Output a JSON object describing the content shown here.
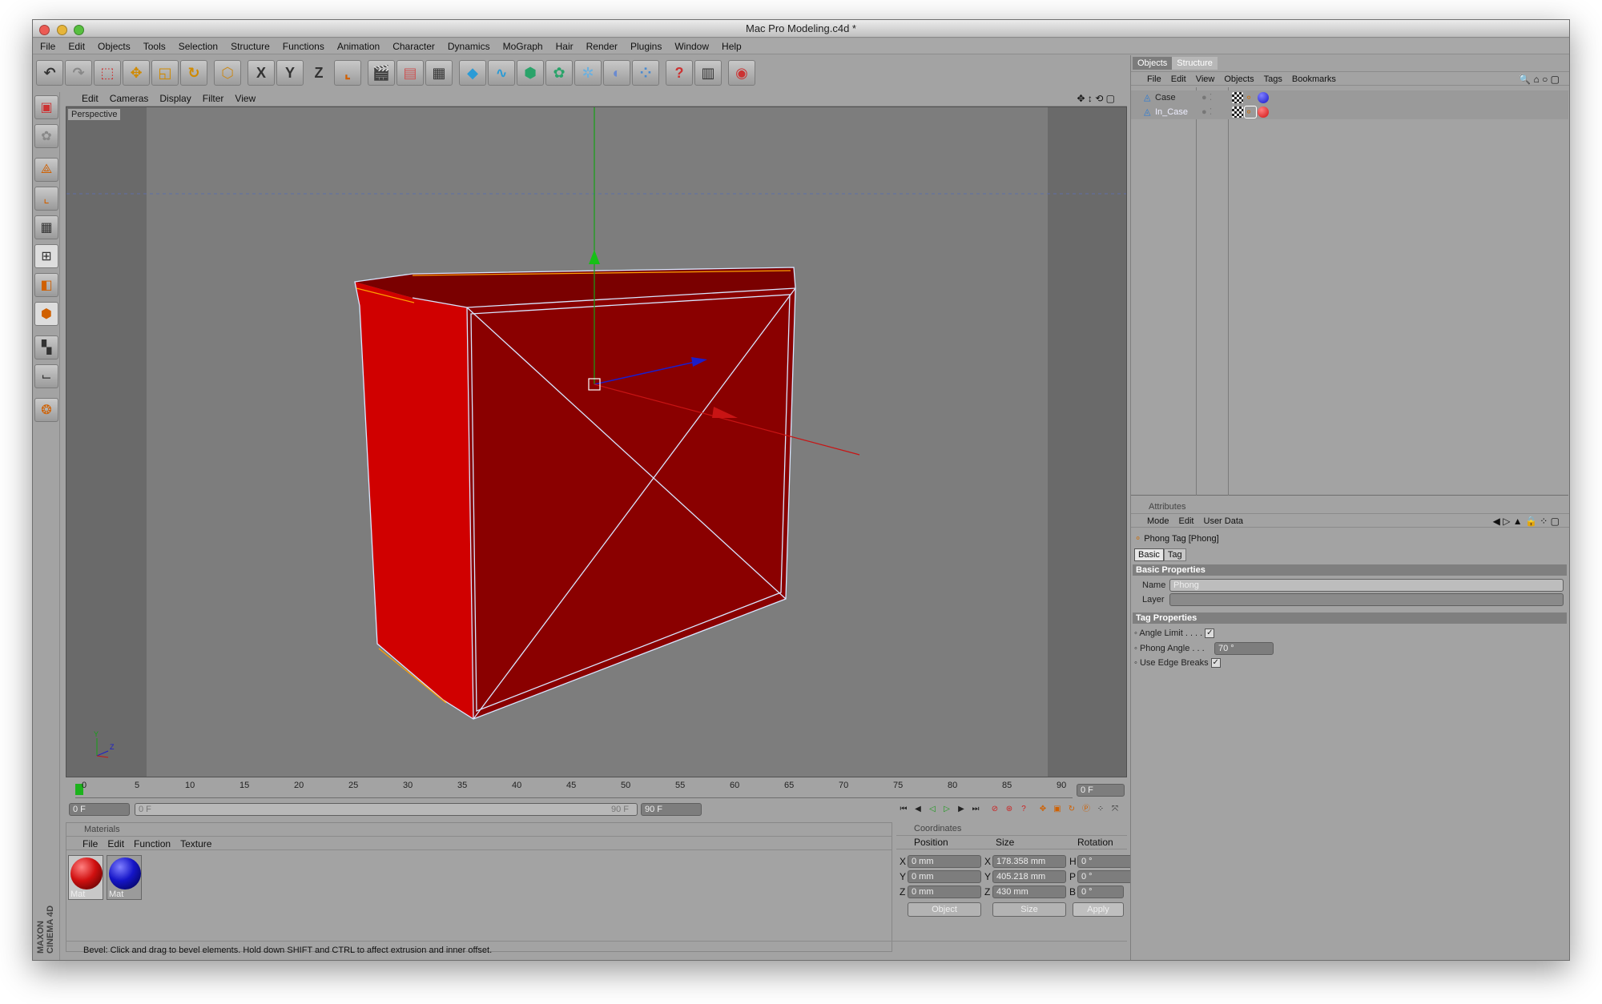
{
  "window": {
    "title": "Mac Pro Modeling.c4d *"
  },
  "menubar": [
    "File",
    "Edit",
    "Objects",
    "Tools",
    "Selection",
    "Structure",
    "Functions",
    "Animation",
    "Character",
    "Dynamics",
    "MoGraph",
    "Hair",
    "Render",
    "Plugins",
    "Window",
    "Help"
  ],
  "toolbar": {
    "axis_x": "X",
    "axis_y": "Y",
    "axis_z": "Z",
    "icons": [
      "undo-icon",
      "redo-icon",
      "live-select-icon",
      "move-icon",
      "scale-icon",
      "rotate-icon",
      "object-icon",
      "x-axis-icon",
      "y-axis-icon",
      "z-axis-icon",
      "coordinate-system-icon",
      "render-view-icon",
      "render-picture-viewer-icon",
      "render-settings-icon",
      "cube-icon",
      "spline-icon",
      "nurbs-icon",
      "array-icon",
      "deformer-icon",
      "scene-icon",
      "particle-icon",
      "help-icon",
      "timeline-icon",
      "web-icon"
    ]
  },
  "viewport": {
    "menu": [
      "Edit",
      "Cameras",
      "Display",
      "Filter",
      "View"
    ],
    "label": "Perspective",
    "axis_labels": {
      "y": "Y",
      "z": "Z"
    }
  },
  "timeline": {
    "ticks": [
      "0",
      "5",
      "10",
      "15",
      "20",
      "25",
      "30",
      "35",
      "40",
      "45",
      "50",
      "55",
      "60",
      "65",
      "70",
      "75",
      "80",
      "85",
      "90"
    ],
    "current_frame": "0 F",
    "start_field": "0 F",
    "slider_left": "0 F",
    "slider_right": "90 F",
    "end_field": "90 F"
  },
  "materials": {
    "header": "Materials",
    "menu": [
      "File",
      "Edit",
      "Function",
      "Texture"
    ],
    "items": [
      {
        "label": "Mat",
        "color": "#d01010"
      },
      {
        "label": "Mat",
        "color": "#1515c8"
      }
    ]
  },
  "coordinates": {
    "header": "Coordinates",
    "col_position": "Position",
    "col_size": "Size",
    "col_rotation": "Rotation",
    "rows": [
      {
        "axis": "X",
        "position": "0 mm",
        "size_axis": "X",
        "size": "178.358 mm",
        "rot_axis": "H",
        "rotation": "0 °"
      },
      {
        "axis": "Y",
        "position": "0 mm",
        "size_axis": "Y",
        "size": "405.218 mm",
        "rot_axis": "P",
        "rotation": "0 °"
      },
      {
        "axis": "Z",
        "position": "0 mm",
        "size_axis": "Z",
        "size": "430 mm",
        "rot_axis": "B",
        "rotation": "0 °"
      }
    ],
    "mode_select": "Object",
    "size_select": "Size",
    "apply_label": "Apply"
  },
  "status": {
    "text": "Bevel: Click and drag to bevel elements. Hold down SHIFT and CTRL to affect extrusion and inner offset."
  },
  "objects_panel": {
    "tabs": {
      "objects": "Objects",
      "structure": "Structure"
    },
    "menu": [
      "File",
      "Edit",
      "View",
      "Objects",
      "Tags",
      "Bookmarks"
    ],
    "rows": [
      {
        "name": "Case",
        "color": "#1515c8"
      },
      {
        "name": "In_Case",
        "color": "#d01010"
      }
    ]
  },
  "attributes": {
    "header": "Attributes",
    "menu": [
      "Mode",
      "Edit",
      "User Data"
    ],
    "object_title": "Phong Tag [Phong]",
    "tabs": [
      "Basic",
      "Tag"
    ],
    "basic_section": "Basic Properties",
    "name_label": "Name",
    "name_value": "Phong",
    "layer_label": "Layer",
    "tag_section": "Tag Properties",
    "angle_limit_label": "Angle Limit . . . .",
    "phong_angle_label": "Phong Angle . . .",
    "phong_angle_value": "70 °",
    "edge_breaks_label": "Use Edge Breaks",
    "checkmark": "✓"
  },
  "brand": {
    "line1": "MAXON",
    "line2": "CINEMA 4D"
  },
  "colors": {
    "accent_red": "#8b0000",
    "wire": "#d8e6ff",
    "axis_x": "#c81414",
    "axis_y": "#16a116",
    "axis_z": "#1d1dc9"
  }
}
